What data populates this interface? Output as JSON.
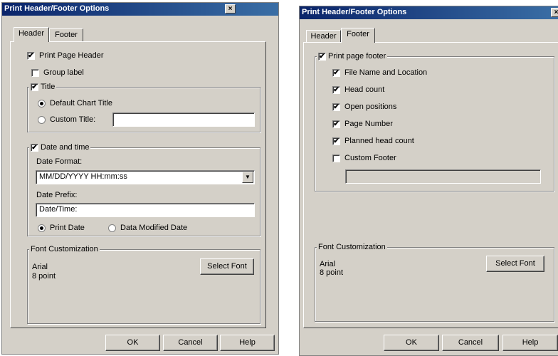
{
  "left_dialog": {
    "title": "Print Header/Footer Options",
    "close_glyph": "×",
    "tabs": [
      {
        "label": "Header"
      },
      {
        "label": "Footer"
      }
    ],
    "print_page_header": {
      "label": "Print Page Header",
      "checked": true
    },
    "group_label": {
      "label": "Group label",
      "checked": false
    },
    "title_group": {
      "legend": "Title",
      "checked": true,
      "default_chart_title": "Default Chart Title",
      "custom_title": "Custom Title:",
      "custom_title_value": ""
    },
    "date_group": {
      "legend": "Date and time",
      "checked": true,
      "date_format_label": "Date Format:",
      "date_format_value": "MM/DD/YYYY HH:mm:ss",
      "date_prefix_label": "Date Prefix:",
      "date_prefix_value": "Date/Time:",
      "print_date": "Print Date",
      "data_modified_date": "Data Modified Date"
    },
    "font_group": {
      "legend": "Font Customization",
      "font_name": "Arial",
      "font_size": "8 point",
      "select_font": "Select Font"
    },
    "buttons": {
      "ok": "OK",
      "cancel": "Cancel",
      "help": "Help"
    }
  },
  "right_dialog": {
    "title": "Print Header/Footer Options",
    "tabs": [
      {
        "label": "Header"
      },
      {
        "label": "Footer"
      }
    ],
    "footer_group": {
      "legend": "Print page footer",
      "checked": true,
      "items": [
        {
          "label": "File Name and Location",
          "checked": true
        },
        {
          "label": "Head count",
          "checked": true
        },
        {
          "label": "Open positions",
          "checked": true
        },
        {
          "label": "Page Number",
          "checked": true
        },
        {
          "label": "Planned head count",
          "checked": true
        },
        {
          "label": "Custom Footer",
          "checked": false
        }
      ],
      "custom_footer_value": ""
    },
    "font_group": {
      "legend": "Font Customization",
      "font_name": "Arial",
      "font_size": "8 point",
      "select_font": "Select Font"
    },
    "buttons": {
      "ok": "OK",
      "cancel": "Cancel",
      "help": "Help"
    }
  },
  "icons": {
    "check": "✔",
    "dropdown": "▼"
  }
}
